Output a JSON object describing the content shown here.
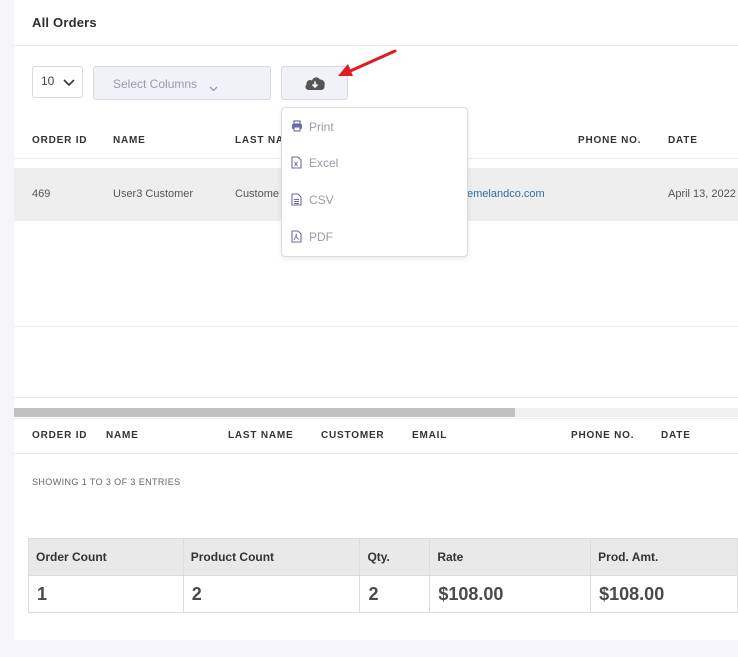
{
  "card": {
    "title": "All Orders"
  },
  "toolbar": {
    "page_length": "10",
    "columns_placeholder": "Select Columns"
  },
  "export_menu": {
    "items": [
      {
        "label": "Print",
        "icon": "printer-icon"
      },
      {
        "label": "Excel",
        "icon": "excel-file-icon"
      },
      {
        "label": "CSV",
        "icon": "csv-file-icon"
      },
      {
        "label": "PDF",
        "icon": "pdf-file-icon"
      }
    ]
  },
  "table": {
    "headers": {
      "order_id": "ORDER ID",
      "name": "NAME",
      "last_name": "LAST NA",
      "phone": "PHONE NO.",
      "date": "DATE"
    },
    "row": {
      "order_id": "469",
      "name": "User3 Customer",
      "last_name": "Custome",
      "email": "emelandco.com",
      "date": "April 13, 2022"
    },
    "footer_headers": {
      "order_id": "ORDER ID",
      "name": "NAME",
      "last_name": "LAST NAME",
      "customer": "CUSTOMER",
      "email": "EMAIL",
      "phone": "PHONE NO.",
      "date": "DATE"
    },
    "info": "SHOWING 1 TO 3 OF 3 ENTRIES"
  },
  "scrollbar": {
    "position": 0,
    "visible_fraction": 0.69
  },
  "summary": {
    "headers": [
      "Order Count",
      "Product Count",
      "Qty.",
      "Rate",
      "Prod. Amt."
    ],
    "values": [
      "1",
      "2",
      "2",
      "$108.00",
      "$108.00"
    ]
  },
  "colors": {
    "arrow": "#e01b24",
    "link": "#2a6ea6",
    "menu_icon": "#6a6aa8"
  }
}
